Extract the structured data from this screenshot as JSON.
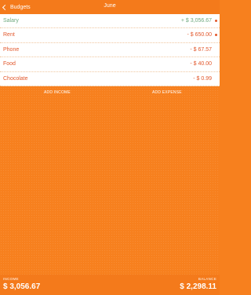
{
  "navbar": {
    "back_label": "Budgets",
    "title": "June"
  },
  "items": [
    {
      "label": "Salary",
      "amount": "+ $ 3,056.67",
      "type": "income"
    },
    {
      "label": "Rent",
      "amount": "- $ 650.00",
      "type": "expense"
    },
    {
      "label": "Phone",
      "amount": "- $ 67.57",
      "type": "expense"
    },
    {
      "label": "Food",
      "amount": "- $ 40.00",
      "type": "expense"
    },
    {
      "label": "Chocolate",
      "amount": "- $ 0.99",
      "type": "expense"
    }
  ],
  "actions": {
    "add_income": "ADD INCOME",
    "add_expense": "ADD EXPENSE"
  },
  "footer": {
    "income_caption": "INCOME",
    "income_value": "$ 3,056.67",
    "balance_caption": "BALANCE",
    "balance_value": "$ 2,298.11"
  },
  "colors": {
    "accent_orange": "#f7801e",
    "income_text": "#6fa97f",
    "expense_text": "#e2582c"
  }
}
